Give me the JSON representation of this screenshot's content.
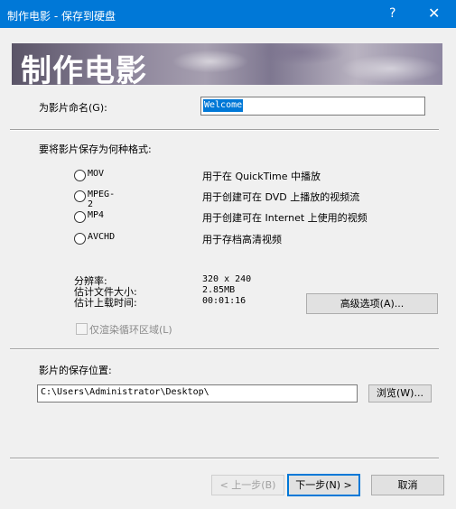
{
  "window": {
    "title": "制作电影 - 保存到硬盘",
    "help_label": "?",
    "close_label": "✕"
  },
  "banner": {
    "title": "制作电影"
  },
  "name_section": {
    "label": "为影片命名(G):",
    "value": "Welcome"
  },
  "format_section": {
    "label": "要将影片保存为何种格式:",
    "options": [
      {
        "label": "MOV",
        "description": "用于在 QuickTime 中播放"
      },
      {
        "label": "MPEG-2",
        "description": "用于创建可在 DVD 上播放的视频流"
      },
      {
        "label": "MP4",
        "description": "用于创建可在 Internet 上使用的视频"
      },
      {
        "label": "AVCHD",
        "description": "用于存档高清视频"
      }
    ]
  },
  "info": {
    "resolution_label": "分辨率:",
    "resolution_value": "320 x 240",
    "filesize_label": "估计文件大小:",
    "filesize_value": "2.85MB",
    "upload_label": "估计上载时间:",
    "upload_value": "00:01:16",
    "advanced_button": "高级选项(A)..."
  },
  "loop_checkbox": {
    "label": "仅渲染循环区域(L)"
  },
  "location_section": {
    "label": "影片的保存位置:",
    "path": "C:\\Users\\Administrator\\Desktop\\",
    "browse_button": "浏览(W)..."
  },
  "footer": {
    "back_button": "< 上一步(B)",
    "next_button": "下一步(N) >",
    "cancel_button": "取消"
  }
}
